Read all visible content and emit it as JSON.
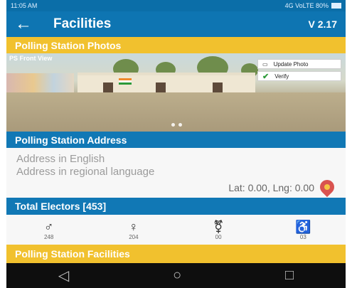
{
  "status_bar": {
    "time": "11:05 AM",
    "signal_text": "4G VoLTE 80%"
  },
  "app_bar": {
    "back_icon": "arrow-left-icon",
    "title": "Facilities",
    "version": "V 2.17"
  },
  "photos": {
    "header": "Polling Station Photos",
    "photo_label": "PS Front View",
    "update_label": "Update Photo",
    "verify_label": "Verify",
    "verify_color": "#2e9b3a"
  },
  "address": {
    "header": "Polling Station Address",
    "english": "Address in English",
    "regional": "Address in regional language",
    "latlng": "Lat: 0.00, Lng: 0.00"
  },
  "electors": {
    "header": "Total Electors [453]",
    "items": [
      {
        "icon": "male-icon",
        "count": "248"
      },
      {
        "icon": "female-icon",
        "count": "204"
      },
      {
        "icon": "third-gender-icon",
        "count": "00"
      },
      {
        "icon": "wheelchair-icon",
        "count": "03"
      }
    ]
  },
  "facilities": {
    "header": "Polling Station Facilities"
  },
  "colors": {
    "primary": "#0e75b2",
    "accent": "#f1c12e"
  }
}
